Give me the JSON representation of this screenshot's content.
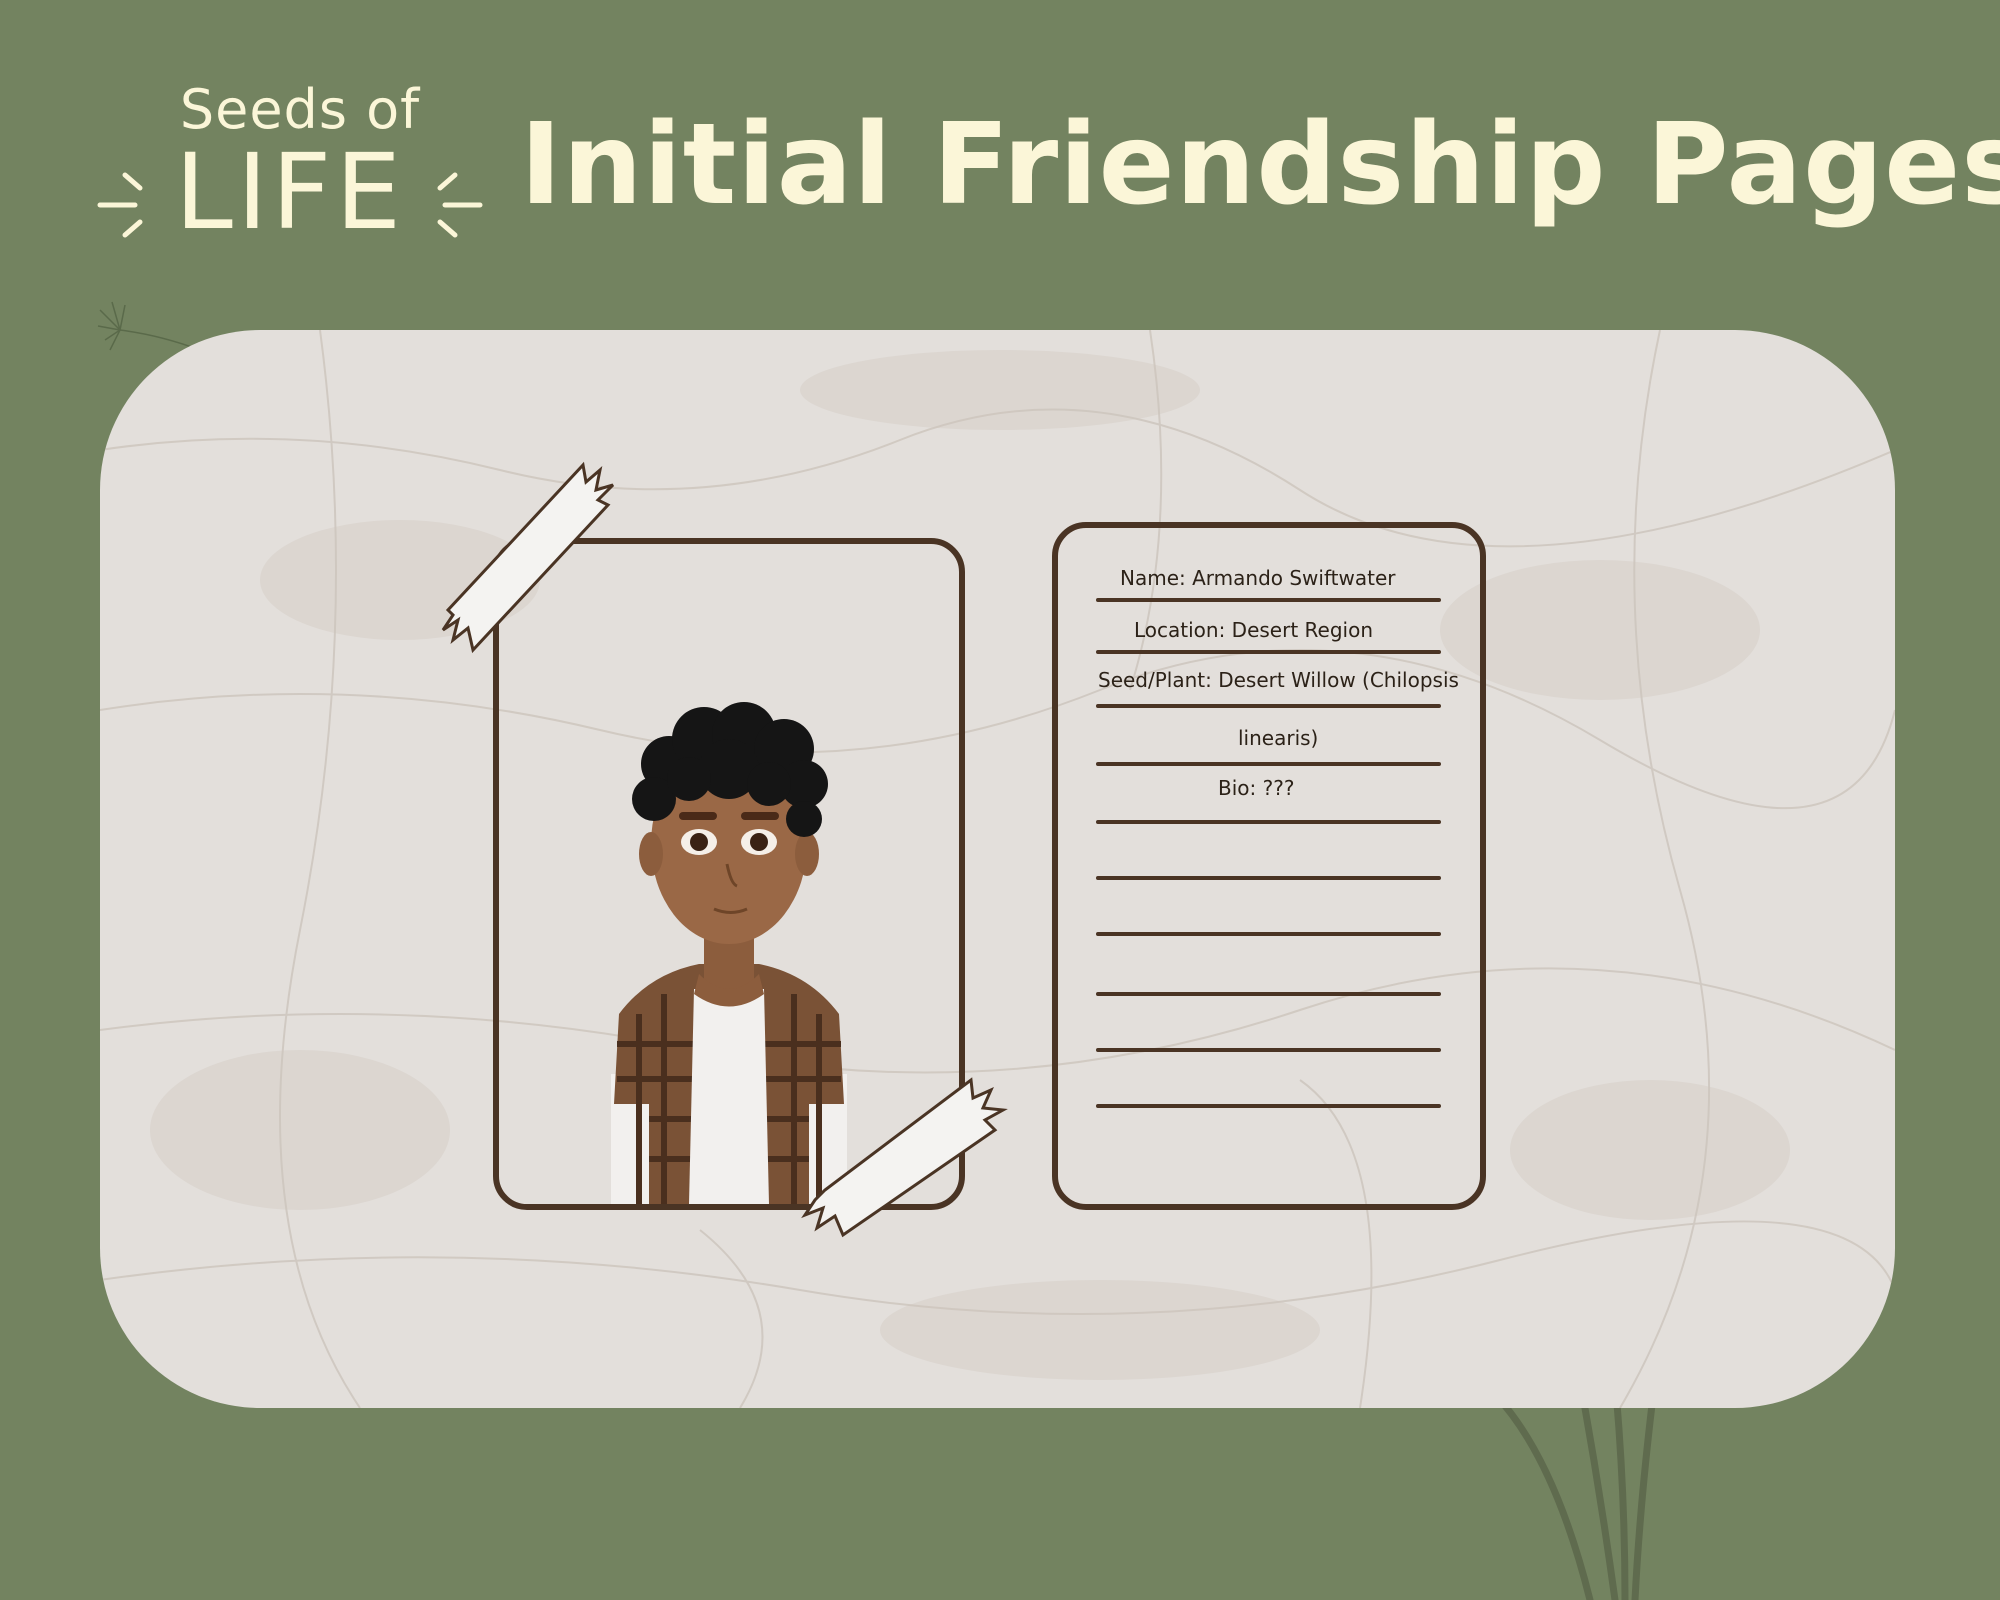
{
  "logo": {
    "line1": "Seeds of",
    "line2": "LIFE"
  },
  "title": "Initial Friendship Pages",
  "colors": {
    "background": "#738360",
    "panel": "#e3dfdb",
    "ink": "#4a3424",
    "title_text": "#fbf6d8"
  },
  "profile": {
    "name": "Name: Armando Swiftwater",
    "location": "Location: Desert Region",
    "seed_plant_line1": "Seed/Plant:  Desert Willow (Chilopsis",
    "seed_plant_line2": "linearis)",
    "bio": "Bio: ???"
  },
  "icons": {
    "logo_rays": "sparkle-rays-icon",
    "dandelion": "dandelion-icon",
    "tape": "washi-tape-icon",
    "stems": "plant-stems-icon"
  }
}
